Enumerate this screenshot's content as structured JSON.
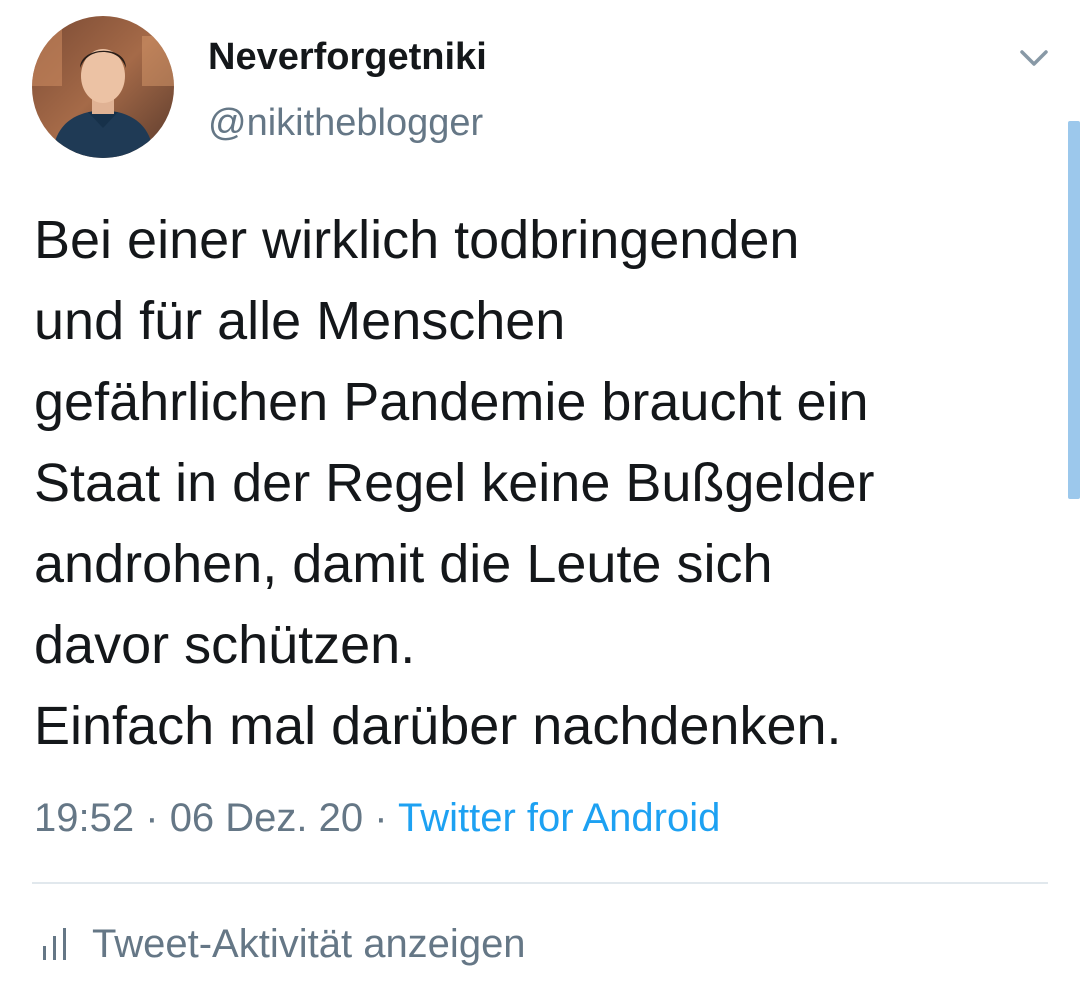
{
  "author": {
    "display_name": "Neverforgetniki",
    "handle": "@nikitheblogger",
    "avatar_icon": "avatar-photo"
  },
  "tweet": {
    "lines": [
      "Bei einer wirklich todbringenden",
      "und für alle Menschen",
      "gefährlichen Pandemie braucht ein",
      "Staat in der Regel keine Bußgelder",
      "androhen, damit die Leute sich",
      "davor schützen.",
      "Einfach mal darüber nachdenken."
    ],
    "time": "19:52",
    "date": "06 Dez. 20",
    "separator": "·",
    "source": "Twitter for Android"
  },
  "actions": {
    "activity_label": "Tweet-Aktivität anzeigen",
    "activity_icon": "bar-chart-icon",
    "menu_icon": "chevron-down-icon"
  },
  "colors": {
    "text": "#14171a",
    "secondary": "#657786",
    "link": "#1da1f2",
    "divider": "#e1e8ed"
  }
}
